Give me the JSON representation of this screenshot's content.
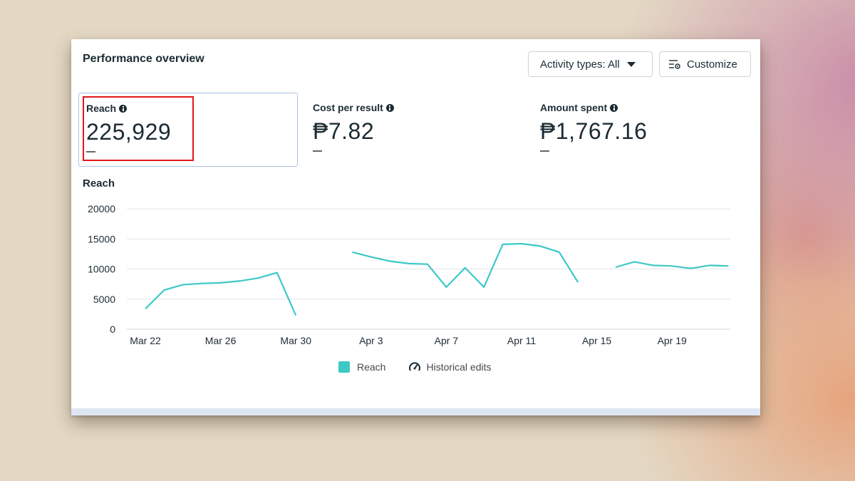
{
  "panel": {
    "title": "Performance overview",
    "activity_button": "Activity types: All",
    "customize_button": "Customize"
  },
  "metrics": [
    {
      "label": "Reach",
      "value": "225,929",
      "change": "—",
      "selected": true
    },
    {
      "label": "Cost per result",
      "value": "₱7.82",
      "change": "—",
      "selected": false
    },
    {
      "label": "Amount spent",
      "value": "₱1,767.16",
      "change": "—",
      "selected": false
    }
  ],
  "chart": {
    "title": "Reach",
    "legend": {
      "series": "Reach",
      "historical": "Historical edits"
    }
  },
  "colors": {
    "series": "#3ec8c8",
    "highlight": "#e1161b",
    "selected_border": "#a9c5e4"
  },
  "chart_data": {
    "type": "line",
    "title": "Reach",
    "ylim": [
      0,
      20000
    ],
    "yticks": [
      0,
      5000,
      10000,
      15000,
      20000
    ],
    "xtick_labels": [
      "Mar 22",
      "Mar 26",
      "Mar 30",
      "Apr 3",
      "Apr 7",
      "Apr 11",
      "Apr 15",
      "Apr 19"
    ],
    "x": [
      "Mar 22",
      "Mar 23",
      "Mar 24",
      "Mar 25",
      "Mar 26",
      "Mar 27",
      "Mar 28",
      "Mar 29",
      "Mar 30",
      "Mar 31",
      "Apr 1",
      "Apr 2",
      "Apr 3",
      "Apr 4",
      "Apr 5",
      "Apr 6",
      "Apr 7",
      "Apr 8",
      "Apr 9",
      "Apr 10",
      "Apr 11",
      "Apr 12",
      "Apr 13",
      "Apr 14",
      "Apr 15",
      "Apr 16",
      "Apr 17",
      "Apr 18",
      "Apr 19",
      "Apr 20",
      "Apr 21",
      "Apr 22"
    ],
    "series": [
      {
        "name": "Reach",
        "values": [
          3400,
          6500,
          7400,
          7600,
          7700,
          8000,
          8500,
          9400,
          2300,
          null,
          null,
          12800,
          12000,
          11300,
          10900,
          10800,
          7000,
          10200,
          7000,
          14100,
          14200,
          13800,
          12800,
          7800,
          null,
          10300,
          11200,
          10600,
          10500,
          10100,
          10600,
          10500
        ]
      },
      {
        "name": "Reach",
        "values": []
      }
    ],
    "series_note": "",
    "legend": [
      "Reach",
      "Historical edits"
    ],
    "grid": true
  }
}
